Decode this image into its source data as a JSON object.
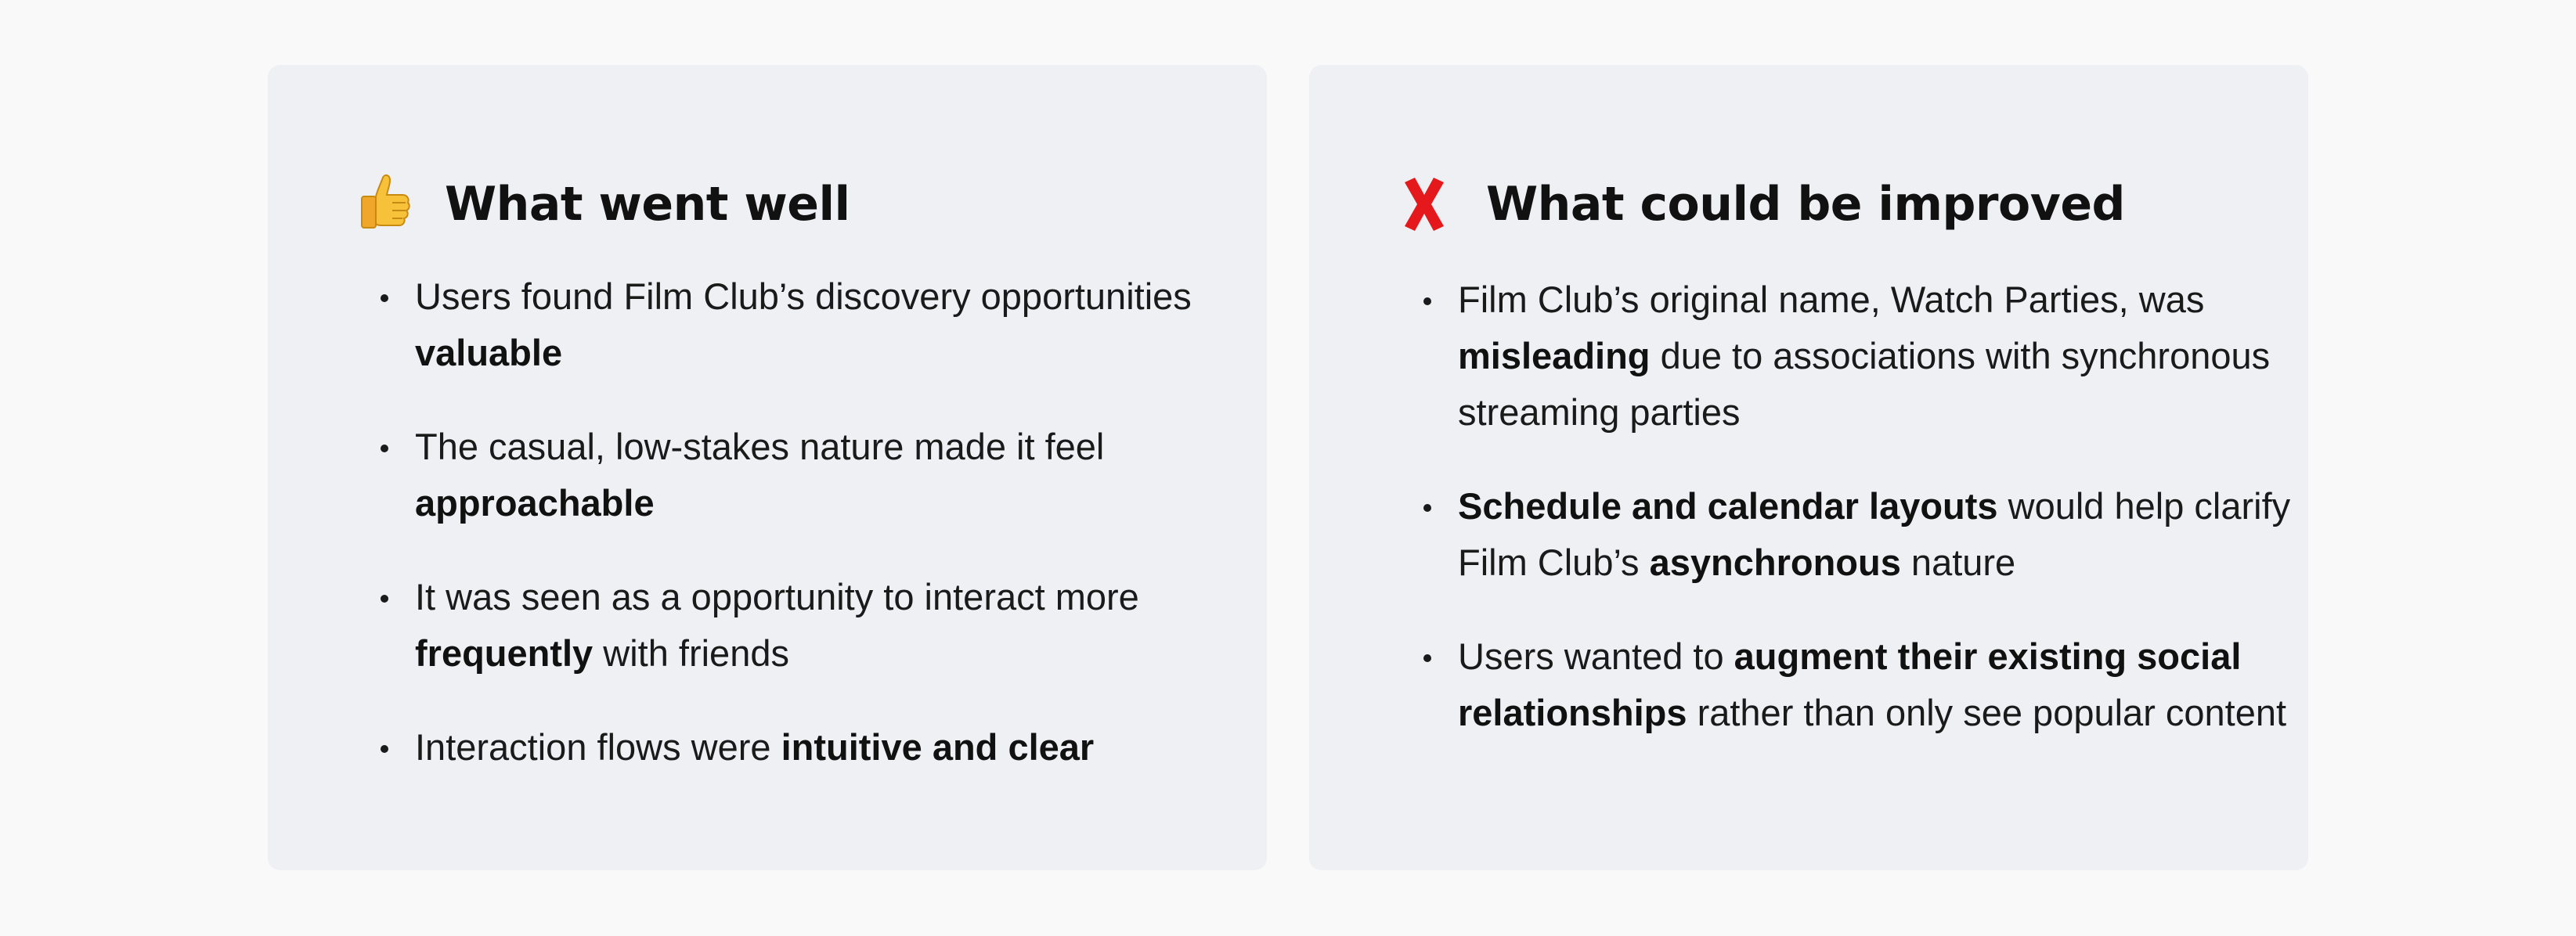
{
  "left_card": {
    "icon": "thumbs-up-icon",
    "title": "What went well",
    "items": [
      {
        "plain": "Users found Film Club’s discovery opportunities ",
        "bold": "valuable",
        "after": ""
      },
      {
        "plain": "The casual, low-stakes nature made it feel ",
        "bold": "approachable",
        "after": ""
      },
      {
        "plain": "It was seen as a opportunity to interact more ",
        "bold": "frequently",
        "after": " with friends"
      },
      {
        "plain": "Interaction flows were ",
        "bold": "intuitive and clear",
        "after": ""
      }
    ]
  },
  "right_card": {
    "icon": "cross-mark-icon",
    "title": "What could be improved",
    "items": [
      {
        "a": "Film Club’s original name, Watch Parties, was ",
        "b": "misleading",
        "c": " due to associations with synchronous streaming parties",
        "d": "",
        "e": ""
      },
      {
        "a": "",
        "b": "Schedule and calendar layouts",
        "c": " would help clarify Film Club’s ",
        "d": "asynchronous",
        "e": " nature"
      },
      {
        "a": "Users wanted to ",
        "b": "augment their existing social relationships",
        "c": " rather than only see popular content",
        "d": "",
        "e": ""
      }
    ]
  },
  "colors": {
    "page_bg": "#f9f9f9",
    "card_bg": "#eff0f4",
    "thumb_yellow": "#f7c23a",
    "cross_red": "#e5191c"
  }
}
